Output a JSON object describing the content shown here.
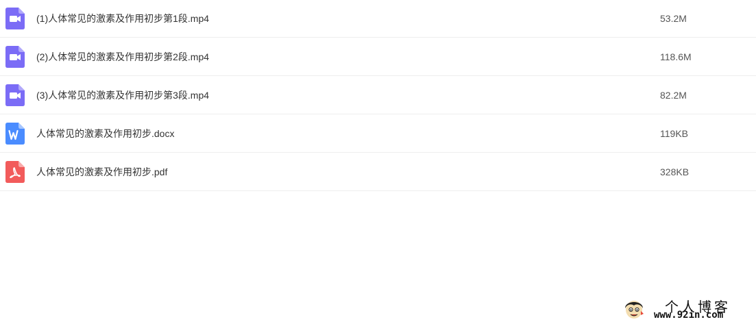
{
  "files": [
    {
      "name": "(1)人体常见的激素及作用初步第1段.mp4",
      "size": "53.2M",
      "icon": "video-file-icon",
      "color": "#7b6cf6"
    },
    {
      "name": "(2)人体常见的激素及作用初步第2段.mp4",
      "size": "118.6M",
      "icon": "video-file-icon",
      "color": "#7b6cf6"
    },
    {
      "name": "(3)人体常见的激素及作用初步第3段.mp4",
      "size": "82.2M",
      "icon": "video-file-icon",
      "color": "#7b6cf6"
    },
    {
      "name": "人体常见的激素及作用初步.docx",
      "size": "119KB",
      "icon": "word-file-icon",
      "color": "#4a8cff"
    },
    {
      "name": "人体常见的激素及作用初步.pdf",
      "size": "328KB",
      "icon": "pdf-file-icon",
      "color": "#f25b5b"
    }
  ],
  "watermark": {
    "title": "个人博客",
    "url": "www.92in.com"
  }
}
